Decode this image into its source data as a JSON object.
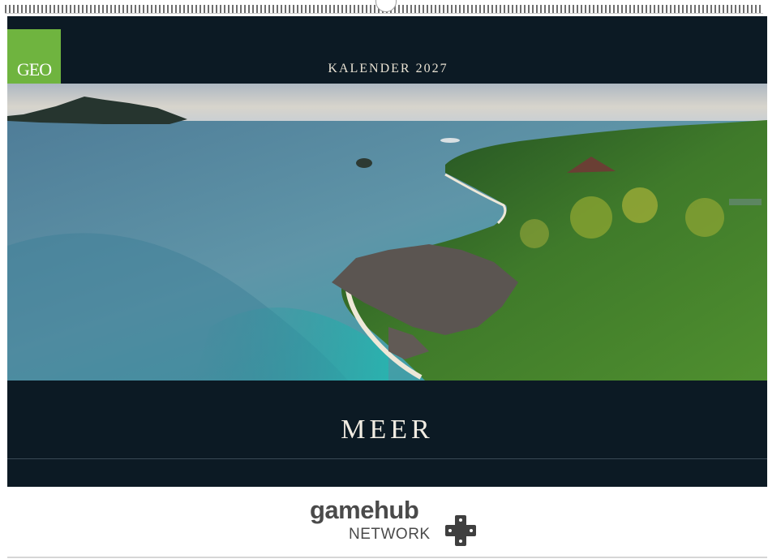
{
  "publisher": {
    "logo_text": "GEO",
    "brand_color": "#6fb43f"
  },
  "calendar": {
    "subtitle": "KALENDER 2027",
    "title": "MEER",
    "band_color": "#0c1a24"
  },
  "photo": {
    "subject": "tropical-coast-aerial-photo"
  },
  "footer": {
    "brand_main": "gamehub",
    "brand_sub": "NETWORK",
    "brand_icon": "plus-icon",
    "text_color": "#4a4a4a"
  }
}
